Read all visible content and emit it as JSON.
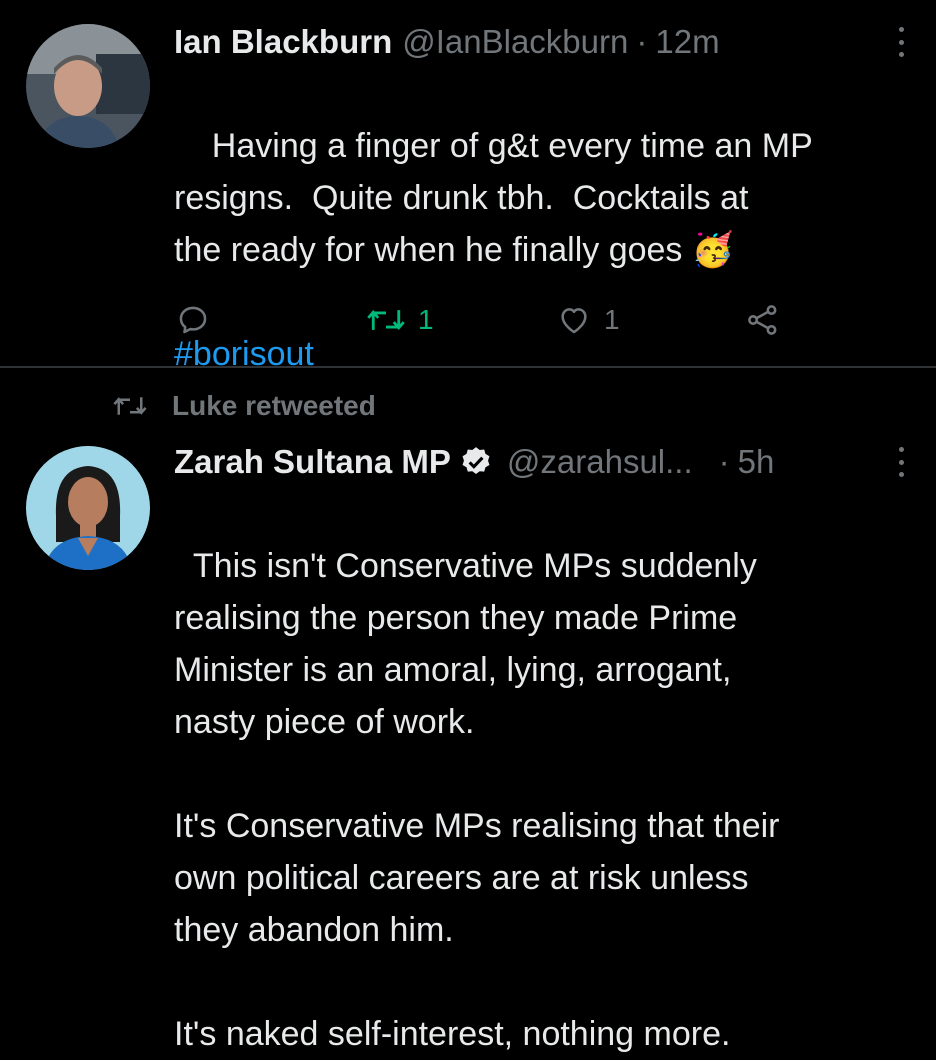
{
  "colors": {
    "background": "#000000",
    "text": "#e7e9ea",
    "muted": "#71767b",
    "link": "#1d9bf0",
    "retweet_active": "#00ba7c",
    "divider": "#2f3336"
  },
  "tweet1": {
    "name": "Ian Blackburn",
    "handle": "@IanBlackburn",
    "separator": "·",
    "time": "12m",
    "text": "Having a finger of g&t every time an MP\nresigns.  Quite drunk tbh.  Cocktails at\nthe ready for when he finally goes 🥳",
    "hashtag": "#borisout",
    "actions": {
      "reply_icon": "reply-icon",
      "retweet_icon": "retweet-icon",
      "retweet_count": "1",
      "like_icon": "heart-icon",
      "like_count": "1",
      "share_icon": "share-icon"
    }
  },
  "retweet_context": {
    "icon": "retweet-icon",
    "label": "Luke retweeted"
  },
  "tweet2": {
    "name": "Zarah Sultana MP",
    "verified_icon": "verified-badge-icon",
    "handle": "@zarahsul...",
    "separator": "·",
    "time": "5h",
    "text": "This isn't Conservative MPs suddenly\nrealising the person they made Prime\nMinister is an amoral, lying, arrogant,\nnasty piece of work.\n\nIt's Conservative MPs realising that their\nown political careers are at risk unless\nthey abandon him.\n\nIt's naked self-interest, nothing more."
  }
}
